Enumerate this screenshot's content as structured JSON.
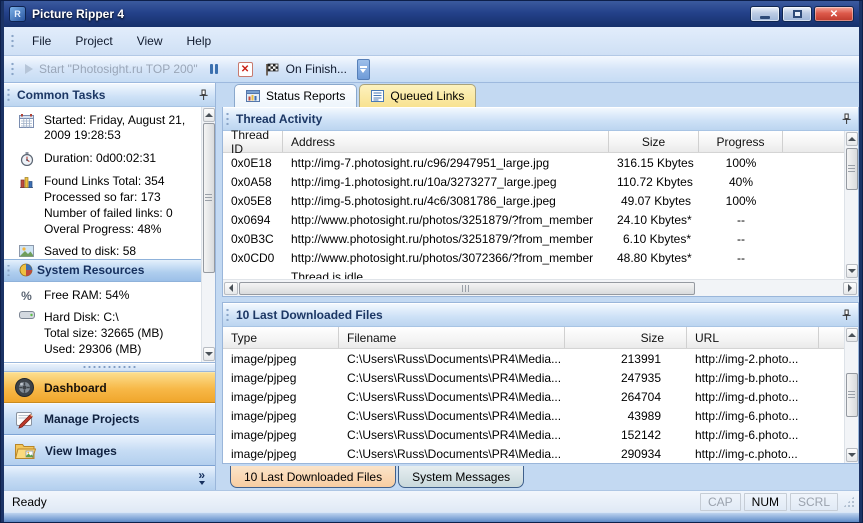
{
  "window": {
    "title": "Picture Ripper 4",
    "close_glyph": "✕"
  },
  "menu": {
    "items": [
      "File",
      "Project",
      "View",
      "Help"
    ]
  },
  "toolbar": {
    "start_label": "Start \"Photosight.ru TOP 200\"",
    "on_finish_label": "On Finish..."
  },
  "sidebar": {
    "common_tasks": {
      "title": "Common Tasks",
      "items": [
        {
          "icon": "calendar-icon",
          "text": "Started: Friday, August 21, 2009 19:28:53"
        },
        {
          "icon": "stopwatch-icon",
          "text": "Duration: 0d00:02:31"
        },
        {
          "icon": "bar-chart-icon",
          "text": "Found Links Total: 354\nProcessed so far: 173\nNumber of failed links: 0\nOveral Progress: 48%"
        },
        {
          "icon": "picture-icon",
          "text": "Saved to disk: 58"
        }
      ]
    },
    "system_resources": {
      "title": "System Resources",
      "items": [
        {
          "icon": "percent-icon",
          "text": "Free RAM: 54%"
        },
        {
          "icon": "hard-disk-icon",
          "text": "Hard Disk: C:\\\nTotal size: 32665 (MB)\nUsed: 29306 (MB)"
        }
      ]
    },
    "nav": {
      "dashboard": "Dashboard",
      "manage_projects": "Manage Projects",
      "view_images": "View Images",
      "chevrons_glyph": "»"
    }
  },
  "icons": {
    "percent_glyph": "%",
    "stop_glyph": "✕"
  },
  "main_tabs": {
    "status_reports": "Status Reports",
    "queued_links": "Queued Links"
  },
  "thread_activity": {
    "title": "Thread Activity",
    "columns": [
      "Thread ID",
      "Address",
      "Size",
      "Progress"
    ],
    "rows": [
      [
        "0x0E18",
        "http://img-7.photosight.ru/c96/2947951_large.jpg",
        "316.15 Kbytes",
        "100%"
      ],
      [
        "0x0A58",
        "http://img-1.photosight.ru/10a/3273277_large.jpeg",
        "110.72 Kbytes",
        "40%"
      ],
      [
        "0x05E8",
        "http://img-5.photosight.ru/4c6/3081786_large.jpeg",
        "49.07 Kbytes",
        "100%"
      ],
      [
        "0x0694",
        "http://www.photosight.ru/photos/3251879/?from_member",
        "24.10 Kbytes*",
        "--"
      ],
      [
        "0x0B3C",
        "http://www.photosight.ru/photos/3251879/?from_member",
        "6.10 Kbytes*",
        "--"
      ],
      [
        "0x0CD0",
        "http://www.photosight.ru/photos/3072366/?from_member",
        "48.80 Kbytes*",
        "--"
      ],
      [
        "",
        "Thread is idle",
        "",
        ""
      ]
    ]
  },
  "downloaded_files": {
    "title": "10 Last Downloaded Files",
    "columns": [
      "Type",
      "Filename",
      "Size",
      "URL"
    ],
    "rows": [
      [
        "image/pjpeg",
        "C:\\Users\\Russ\\Documents\\PR4\\Media...",
        "213991",
        "http://img-2.photo..."
      ],
      [
        "image/pjpeg",
        "C:\\Users\\Russ\\Documents\\PR4\\Media...",
        "247935",
        "http://img-b.photo..."
      ],
      [
        "image/pjpeg",
        "C:\\Users\\Russ\\Documents\\PR4\\Media...",
        "264704",
        "http://img-d.photo..."
      ],
      [
        "image/pjpeg",
        "C:\\Users\\Russ\\Documents\\PR4\\Media...",
        "43989",
        "http://img-6.photo..."
      ],
      [
        "image/pjpeg",
        "C:\\Users\\Russ\\Documents\\PR4\\Media...",
        "152142",
        "http://img-6.photo..."
      ],
      [
        "image/pjpeg",
        "C:\\Users\\Russ\\Documents\\PR4\\Media...",
        "290934",
        "http://img-c.photo..."
      ]
    ]
  },
  "bottom_tabs": {
    "downloaded_files": "10 Last Downloaded Files",
    "system_messages": "System Messages"
  },
  "statusbar": {
    "ready": "Ready",
    "caps": "CAP",
    "num": "NUM",
    "scroll": "SCRL"
  }
}
